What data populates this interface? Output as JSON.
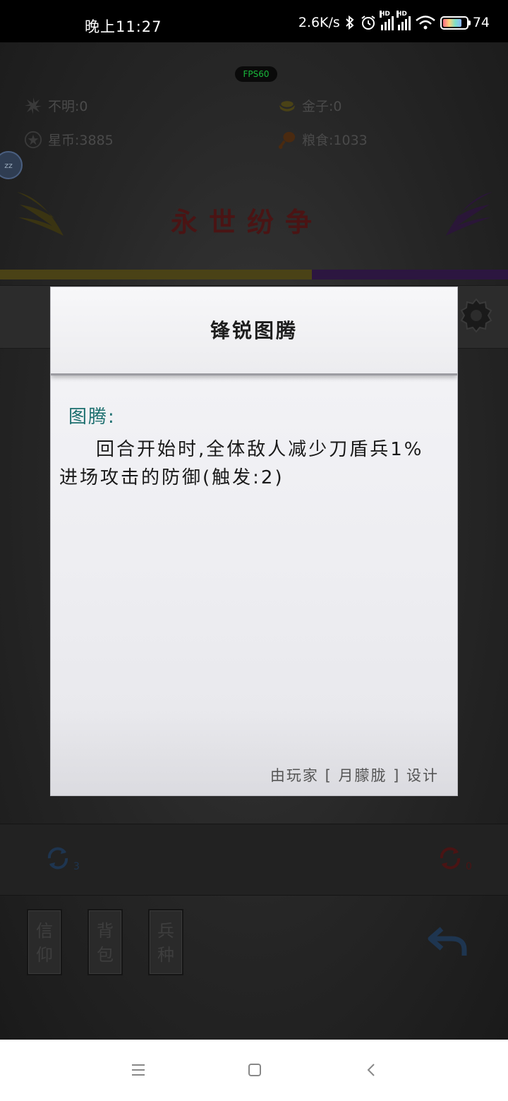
{
  "status_bar": {
    "time": "晚上11:27",
    "net_speed": "2.6K/s",
    "signal_hd_1": "HD",
    "signal_hd_2": "HD",
    "battery": "74"
  },
  "game": {
    "fps": "FPS60",
    "resources": {
      "unknown": "不明:0",
      "gold": "金子:0",
      "star_coins": "星币:3885",
      "food": "粮食:1033"
    },
    "float_button": "zz",
    "battle_title": "永世纷争",
    "left_refresh_count": "3",
    "right_refresh_count": "0",
    "menu": [
      {
        "line1": "信",
        "line2": "仰"
      },
      {
        "line1": "背",
        "line2": "包"
      },
      {
        "line1": "兵",
        "line2": "种"
      }
    ]
  },
  "modal": {
    "title": "锋锐图腾",
    "label": "图腾:",
    "description": "回合开始时,全体敌人减少刀盾兵1%进场攻击的防御(触发:2)",
    "credit": "由玩家 [ 月朦胧 ] 设计"
  },
  "colors": {
    "left_team": "#4a4216",
    "right_team": "#2c1640",
    "label_teal": "#1b6e6e",
    "fps_green": "#18b83a"
  },
  "icons": {
    "nav_recents": "menu-icon",
    "nav_home": "square-icon",
    "nav_back": "back-chevron-icon"
  }
}
